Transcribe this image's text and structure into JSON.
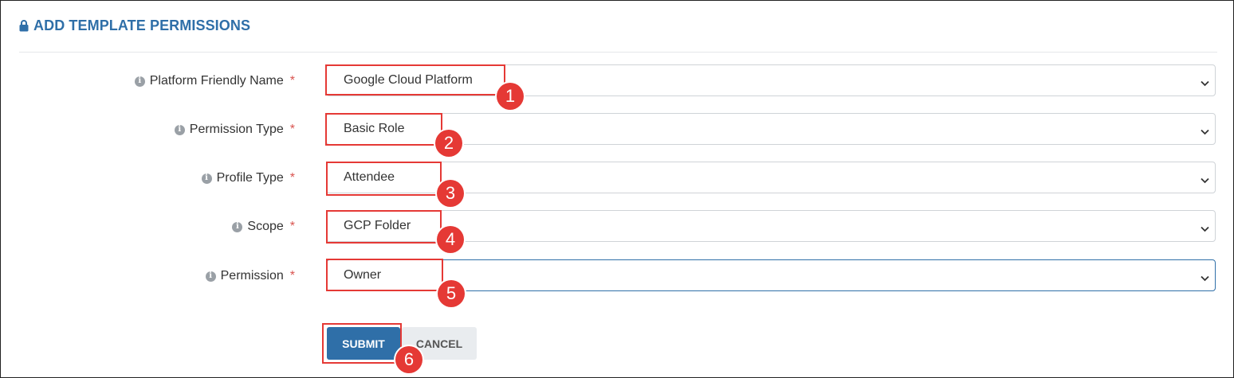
{
  "header": {
    "title": "ADD TEMPLATE PERMISSIONS",
    "icon": "lock-icon"
  },
  "form": {
    "fields": [
      {
        "label": "Platform Friendly Name",
        "required_mark": "*",
        "value": "Google Cloud Platform"
      },
      {
        "label": "Permission Type",
        "required_mark": "*",
        "value": "Basic Role"
      },
      {
        "label": "Profile Type",
        "required_mark": "*",
        "value": "Attendee"
      },
      {
        "label": "Scope",
        "required_mark": "*",
        "value": "GCP Folder"
      },
      {
        "label": "Permission",
        "required_mark": "*",
        "value": "Owner"
      }
    ],
    "submit_label": "SUBMIT",
    "cancel_label": "CANCEL"
  },
  "annotations": {
    "steps": [
      "1",
      "2",
      "3",
      "4",
      "5",
      "6"
    ]
  },
  "colors": {
    "accent": "#2f6fa8",
    "required": "#d9534f",
    "highlight": "#e53935",
    "cancel_bg": "#e9ecef"
  }
}
